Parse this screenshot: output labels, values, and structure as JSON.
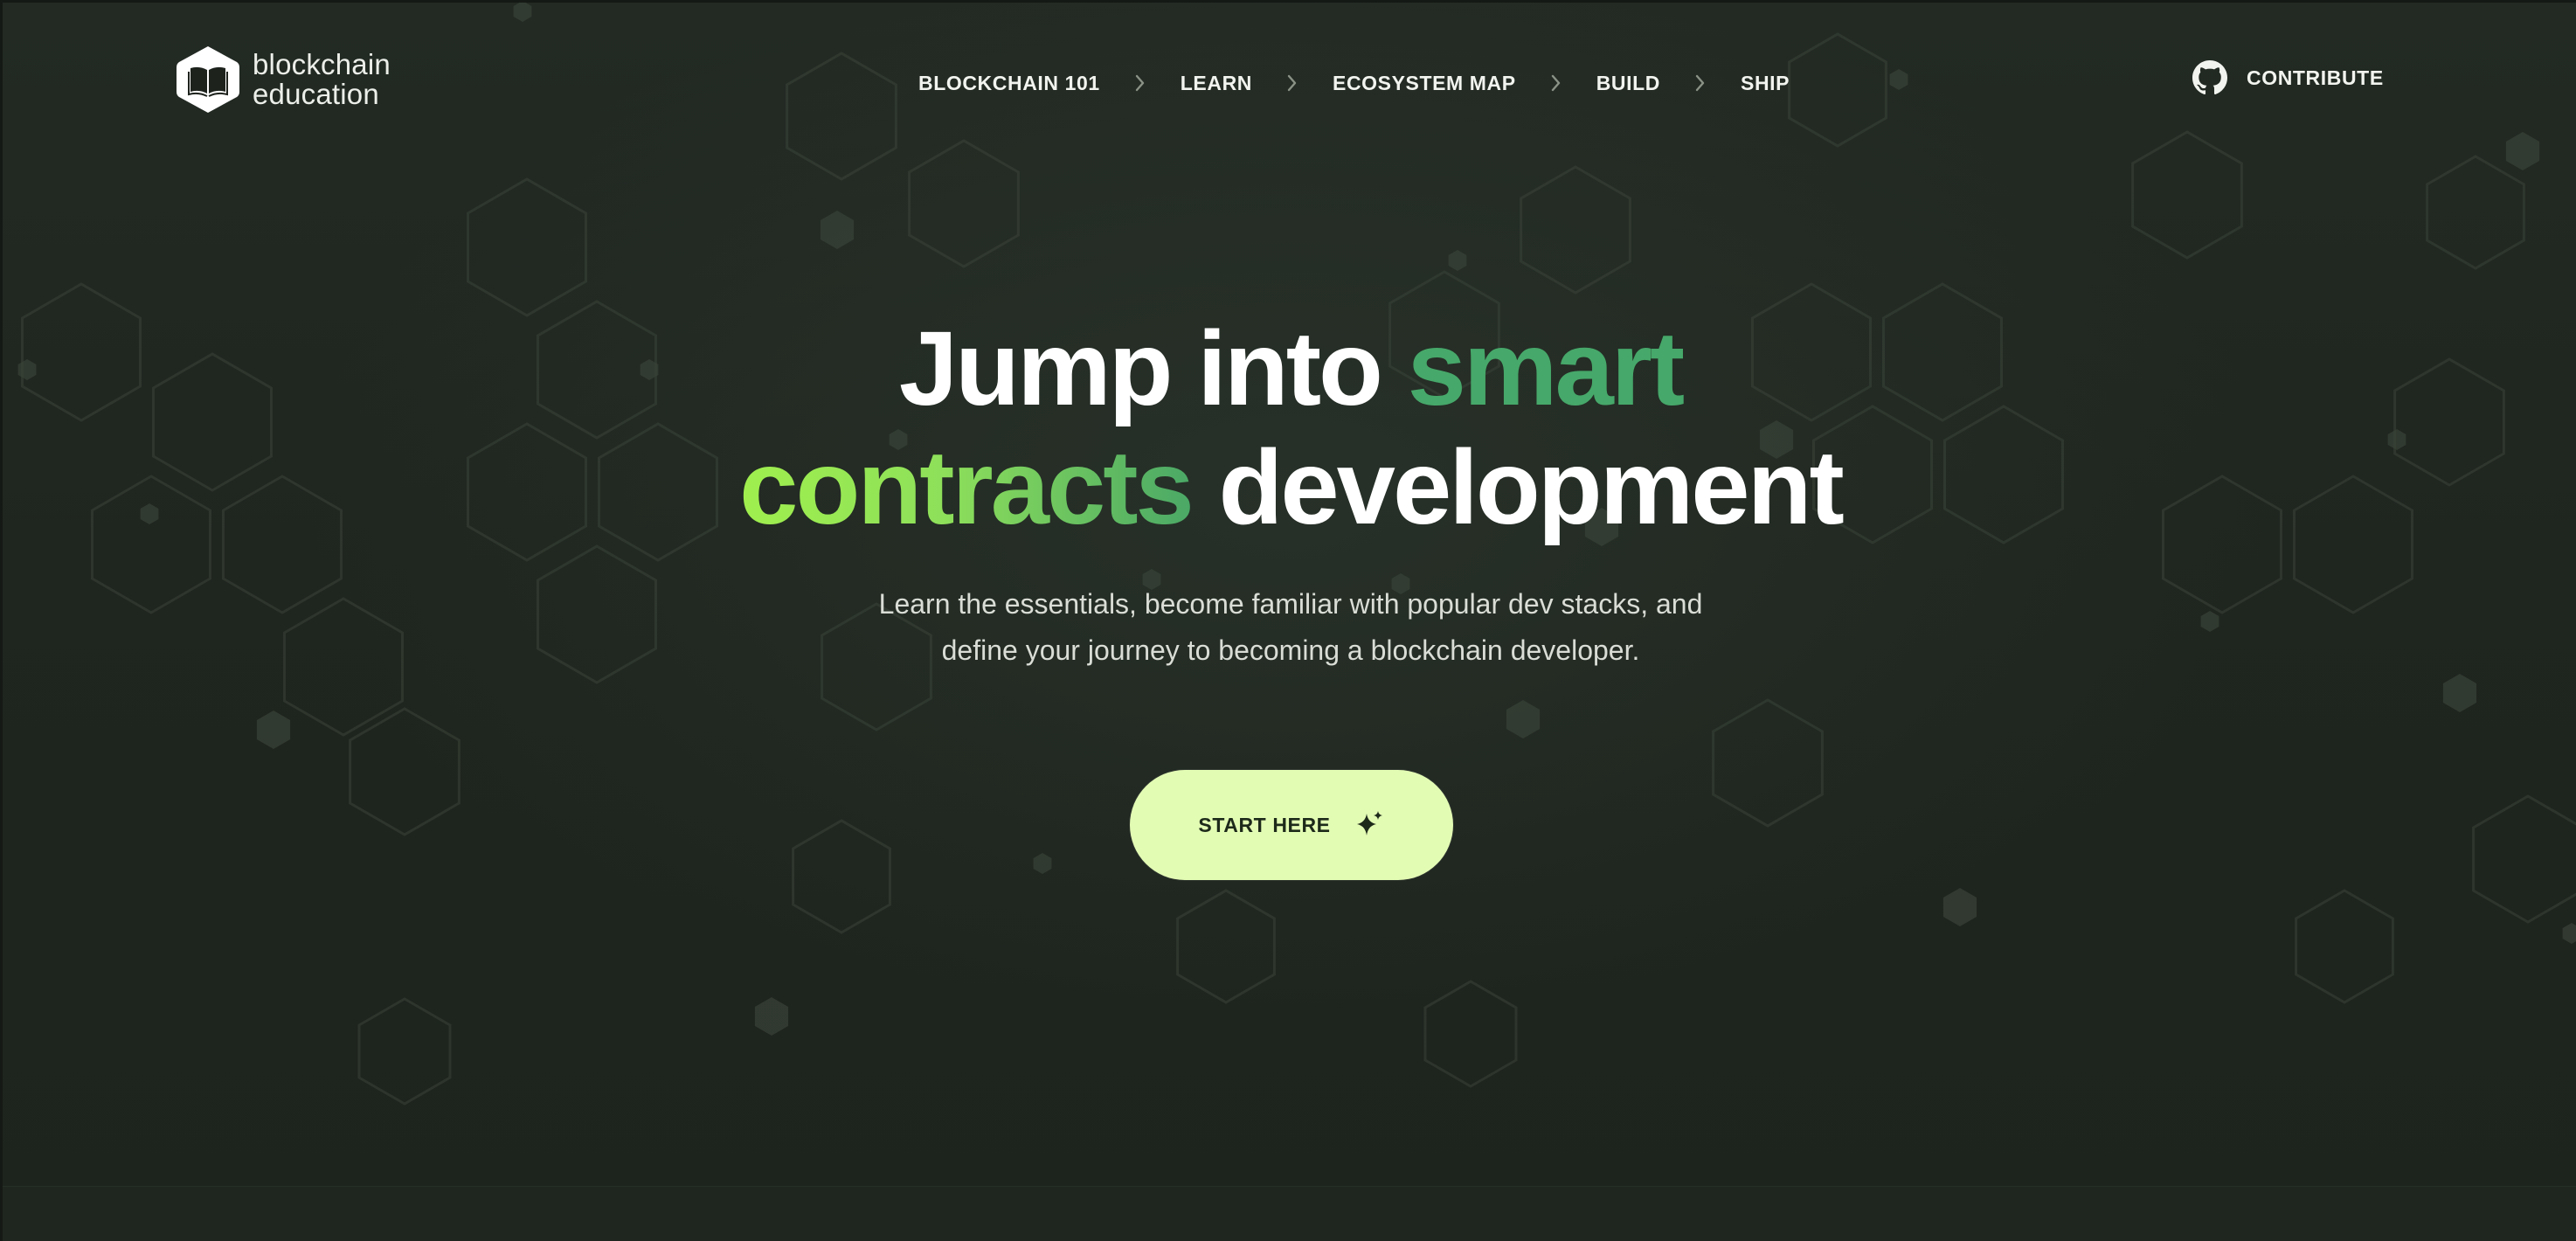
{
  "header": {
    "logo": {
      "line1": "blockchain",
      "line2": "education",
      "icon": "book-hexagon-icon"
    },
    "nav": {
      "items": [
        {
          "label": "BLOCKCHAIN 101"
        },
        {
          "label": "LEARN"
        },
        {
          "label": "ECOSYSTEM MAP"
        },
        {
          "label": "BUILD"
        },
        {
          "label": "SHIP"
        }
      ],
      "separator_icon": "chevron-right-icon"
    },
    "contribute": {
      "label": "CONTRIBUTE",
      "icon": "github-icon"
    }
  },
  "hero": {
    "title": {
      "part1": "Jump into ",
      "part2": "smart",
      "part3": "contracts",
      "part4": " development"
    },
    "subtitle": {
      "line1": "Learn the essentials, become familiar with popular dev stacks, and",
      "line2": "define your journey to becoming a blockchain developer."
    },
    "cta": {
      "label": "START HERE",
      "icon": "sparkle-icon"
    }
  },
  "colors": {
    "background": "#1f251f",
    "accent_green": "#46a86a",
    "accent_lime": "#a0ef4e",
    "cta_background": "#e3fcb4",
    "text": "#ffffff"
  }
}
